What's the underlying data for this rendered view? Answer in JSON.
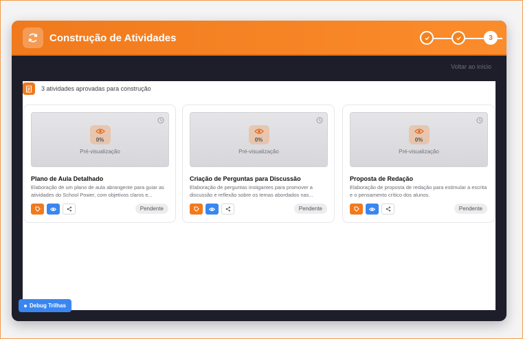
{
  "header": {
    "title": "Construção de Atividades",
    "icon": "refresh-icon",
    "steps": [
      {
        "state": "done",
        "icon": "check-icon"
      },
      {
        "state": "done",
        "icon": "check-icon"
      },
      {
        "state": "current",
        "label": "3"
      }
    ]
  },
  "nav": {
    "back_label": "Voltar ao início"
  },
  "summary": {
    "icon": "document-icon",
    "text": "3 atividades aprovadas para construção"
  },
  "cards": [
    {
      "title": "Plano de Aula Detalhado",
      "description": "Elaboração de um plano de aula abrangente para guiar as atividades do School Power, com objetivos claros e...",
      "progress": "0%",
      "preview_label": "Pré-visualização",
      "status": "Pendente"
    },
    {
      "title": "Criação de Perguntas para Discussão",
      "description": "Elaboração de perguntas instigantes para promover a discussão e reflexão sobre os temas abordados nas...",
      "progress": "0%",
      "preview_label": "Pré-visualização",
      "status": "Pendente"
    },
    {
      "title": "Proposta de Redação",
      "description": "Elaboração de proposta de redação para estimular a escrita e o pensamento crítico dos alunos.",
      "progress": "0%",
      "preview_label": "Pré-visualização",
      "status": "Pendente"
    }
  ],
  "debug": {
    "label": "Debug Trilhas"
  },
  "colors": {
    "accent": "#f07a1d",
    "blue": "#3a86f0",
    "dark": "#1d1e2a"
  }
}
